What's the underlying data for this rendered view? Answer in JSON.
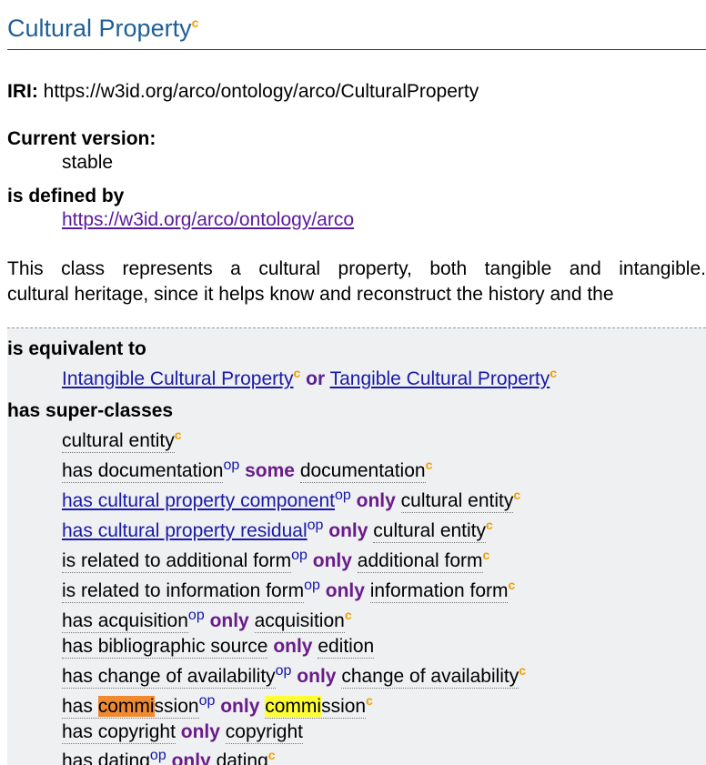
{
  "header": {
    "title": "Cultural Property",
    "marker": "c"
  },
  "iri": {
    "label": "IRI:",
    "value": "https://w3id.org/arco/ontology/arco/CulturalProperty"
  },
  "version": {
    "label": "Current version:",
    "value": "stable"
  },
  "defined_by": {
    "label": "is defined by",
    "link": "https://w3id.org/arco/ontology/arco"
  },
  "description": {
    "line1": "This class represents a cultural property, both tangible and intangible.",
    "line2": "cultural heritage, since it helps know and reconstruct the history and the"
  },
  "equivalent": {
    "label": "is equivalent to",
    "left": "Intangible Cultural Property",
    "op": "or",
    "right": "Tangible Cultural Property",
    "marker": "c"
  },
  "superclasses": {
    "label": "has super-classes",
    "op_marker": "op",
    "c_marker": "c",
    "r1": "cultural entity",
    "r2": {
      "p": "has documentation",
      "k": "some",
      "o": "documentation"
    },
    "r3": {
      "p": "has cultural property component",
      "k": "only",
      "o": "cultural entity"
    },
    "r4": {
      "p": "has cultural property residual",
      "k": "only",
      "o": "cultural entity"
    },
    "r5": {
      "p": "is related to additional form",
      "k": "only",
      "o": "additional form"
    },
    "r6": {
      "p": "is related to information form",
      "k": "only",
      "o": "information form"
    },
    "r7": {
      "p": "has acquisition",
      "k": "only",
      "o": "acquisition"
    },
    "r8": {
      "p": "has bibliographic source",
      "k": "only",
      "o": "edition"
    },
    "r9": {
      "p": "has change of availability",
      "k": "only",
      "o": "change of availability"
    },
    "r10": {
      "p_pre": "has ",
      "p_hl": "commi",
      "p_post": "ssion",
      "k": "only",
      "o_hl": "commi",
      "o_post": "ssion"
    },
    "r11": {
      "p": "has copyright",
      "k": "only",
      "o": "copyright"
    },
    "r12": {
      "p": "has dating",
      "k": "only",
      "o": "dating"
    }
  }
}
